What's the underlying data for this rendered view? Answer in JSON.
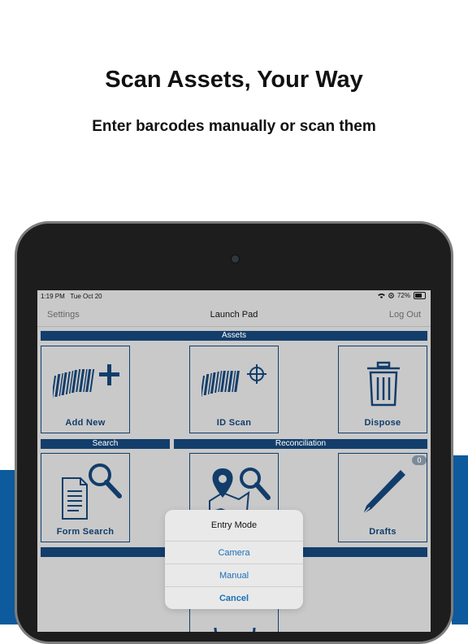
{
  "promo": {
    "headline": "Scan Assets, Your Way",
    "subheadline": "Enter barcodes manually or scan them"
  },
  "status_bar": {
    "time": "1:19 PM",
    "date": "Tue Oct 20",
    "battery": "72%"
  },
  "nav": {
    "left": "Settings",
    "title": "Launch Pad",
    "right": "Log Out"
  },
  "sections": {
    "assets": "Assets",
    "search": "Search",
    "reconciliation": "Reconciliation"
  },
  "tiles": {
    "add_new": "Add New",
    "id_scan": "ID Scan",
    "dispose": "Dispose",
    "form_search": "Form Search",
    "drafts": "Drafts",
    "drafts_count": "0"
  },
  "entry_mode": {
    "title": "Entry Mode",
    "options": [
      "Camera",
      "Manual",
      "Cancel"
    ]
  },
  "colors": {
    "brand_dark": "#133e6b",
    "brand_blue": "#0d5a9c",
    "action_blue": "#1a6fb8"
  }
}
